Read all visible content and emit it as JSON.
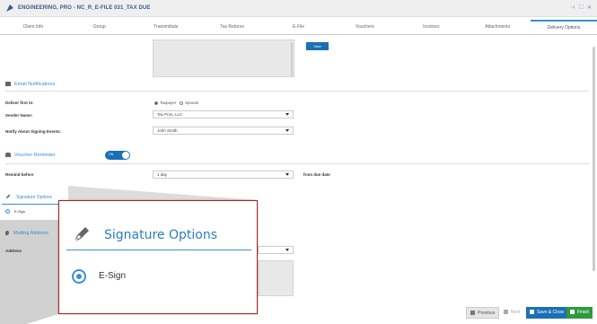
{
  "window": {
    "title": "ENGINEERING, PRO - NC_R_E-FILE 031_TAX DUE",
    "controls": [
      "⊣",
      "⛶",
      "✕"
    ]
  },
  "tabs": [
    {
      "label": "Client Info"
    },
    {
      "label": "Group"
    },
    {
      "label": "Transmittals"
    },
    {
      "label": "Tax Returns"
    },
    {
      "label": "E-File"
    },
    {
      "label": "Vouchers"
    },
    {
      "label": "Invoices"
    },
    {
      "label": "Attachments"
    },
    {
      "label": "Delivery Options",
      "active": true
    }
  ],
  "view_button": "View",
  "email_notifications": {
    "header": "Email Notifications",
    "deliver_first_label": "Deliver first to:",
    "deliver_options": [
      "Taxpayer",
      "Spouse"
    ],
    "sender_name_label": "Sender Name:",
    "sender_name_value": "Tax Pros, LLC",
    "notify_label": "Notify About Signing Events:",
    "notify_value": "John Smith"
  },
  "voucher_reminder": {
    "header": "Voucher Reminder",
    "toggle_text": "ON",
    "remind_label": "Remind before",
    "remind_value": "1 day",
    "remind_suffix": "from due date"
  },
  "signature_options": {
    "header": "Signature Options",
    "option": "E-Sign"
  },
  "mailing_address": {
    "header": "Mailing Address",
    "address_label": "Address"
  },
  "footer": {
    "previous": "Previous",
    "next": "Next",
    "save_close": "Save & Close",
    "finish": "Finish"
  },
  "colors": {
    "accent": "#3a8fd1",
    "primary_button": "#1a6fb5",
    "finish_button": "#2e9a3e",
    "callout_border": "#b02020"
  }
}
